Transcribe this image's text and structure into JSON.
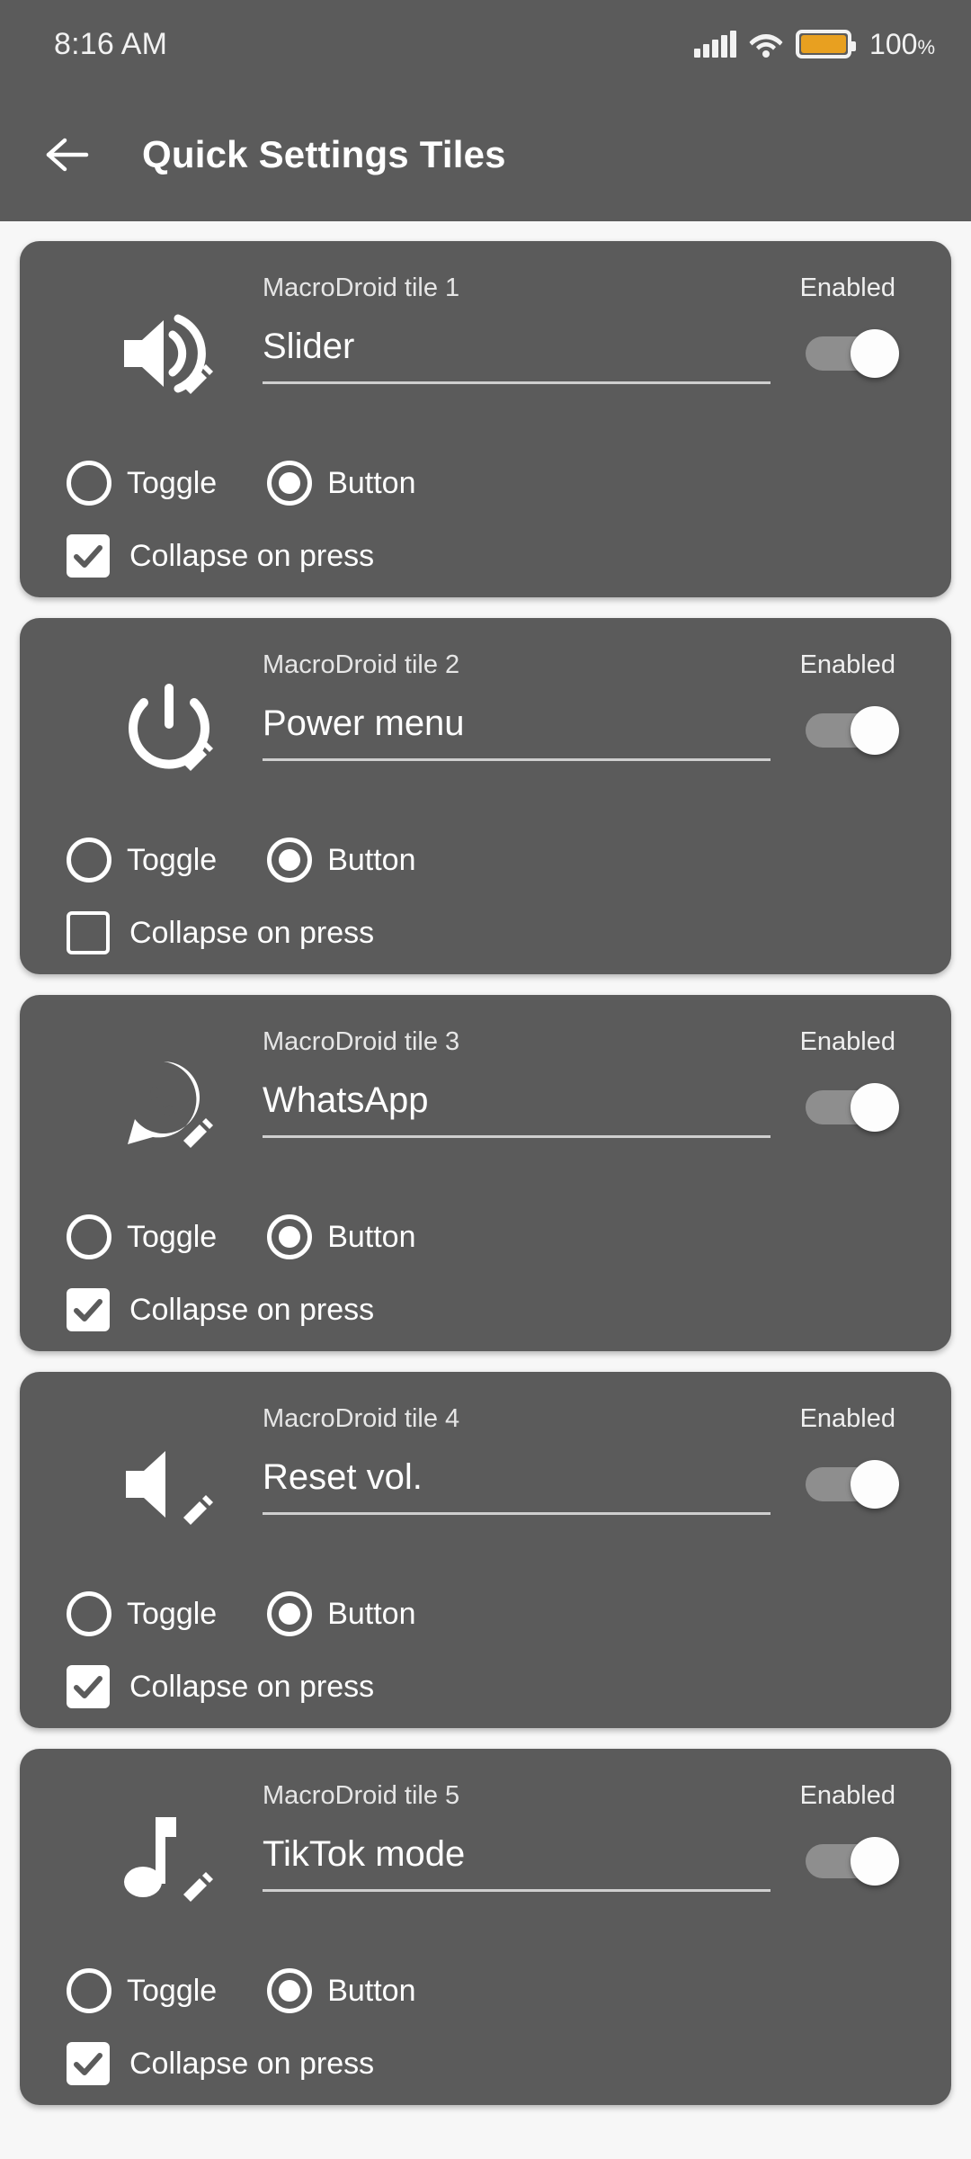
{
  "status_bar": {
    "time": "8:16 AM",
    "battery_percent": "100",
    "percent_unit": "%",
    "icons": [
      "signal-bars-icon",
      "wifi-icon",
      "battery-icon"
    ],
    "battery_color": "#e8a020"
  },
  "app_bar": {
    "back_icon": "back-arrow-icon",
    "title": "Quick Settings Tiles"
  },
  "theme": {
    "page_background": "#f7f7f7",
    "card_background": "#5b5b5b",
    "accent_text": "#ffffff",
    "switch_track": "#8e8e8e",
    "switch_knob": "#fdfdfd"
  },
  "labels": {
    "enabled": "Enabled",
    "toggle": "Toggle",
    "button": "Button",
    "collapse_on_press": "Collapse on press"
  },
  "tiles": [
    {
      "tile_label": "MacroDroid tile 1",
      "name_value": "Slider",
      "icon": "volume-up-icon",
      "enabled_label": "Enabled",
      "enabled": true,
      "mode": "Button",
      "toggle_label": "Toggle",
      "button_label": "Button",
      "collapse_label": "Collapse on press",
      "collapse_on_press": true
    },
    {
      "tile_label": "MacroDroid tile 2",
      "name_value": "Power menu",
      "icon": "power-icon",
      "enabled_label": "Enabled",
      "enabled": true,
      "mode": "Button",
      "toggle_label": "Toggle",
      "button_label": "Button",
      "collapse_label": "Collapse on press",
      "collapse_on_press": false
    },
    {
      "tile_label": "MacroDroid tile 3",
      "name_value": "WhatsApp",
      "icon": "whatsapp-icon",
      "enabled_label": "Enabled",
      "enabled": true,
      "mode": "Button",
      "toggle_label": "Toggle",
      "button_label": "Button",
      "collapse_label": "Collapse on press",
      "collapse_on_press": true
    },
    {
      "tile_label": "MacroDroid tile 4",
      "name_value": "Reset vol.",
      "icon": "volume-mute-icon",
      "enabled_label": "Enabled",
      "enabled": true,
      "mode": "Button",
      "toggle_label": "Toggle",
      "button_label": "Button",
      "collapse_label": "Collapse on press",
      "collapse_on_press": true
    },
    {
      "tile_label": "MacroDroid tile 5",
      "name_value": "TikTok mode",
      "icon": "music-note-icon",
      "enabled_label": "Enabled",
      "enabled": true,
      "mode": "Button",
      "toggle_label": "Toggle",
      "button_label": "Button",
      "collapse_label": "Collapse on press",
      "collapse_on_press": true
    }
  ]
}
